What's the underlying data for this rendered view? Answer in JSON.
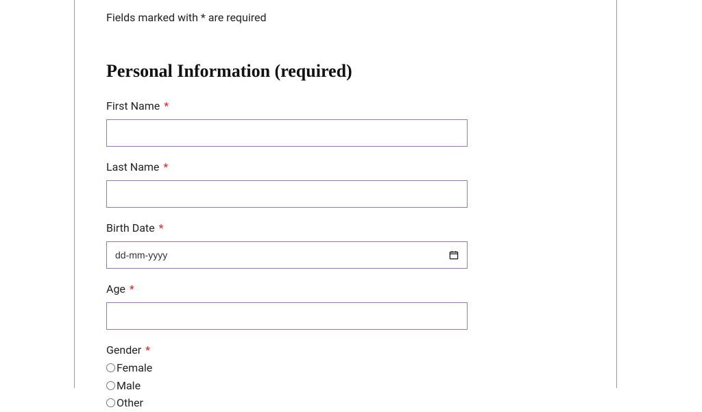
{
  "required_note": "Fields marked with * are required",
  "section_title": "Personal Information (required)",
  "asterisk": "*",
  "fields": {
    "first_name": {
      "label": "First Name",
      "value": ""
    },
    "last_name": {
      "label": "Last Name",
      "value": ""
    },
    "birth_date": {
      "label": "Birth Date",
      "placeholder": "dd-mm-yyyy",
      "value": ""
    },
    "age": {
      "label": "Age",
      "value": ""
    },
    "gender": {
      "label": "Gender",
      "options": [
        "Female",
        "Male",
        "Other"
      ]
    }
  }
}
